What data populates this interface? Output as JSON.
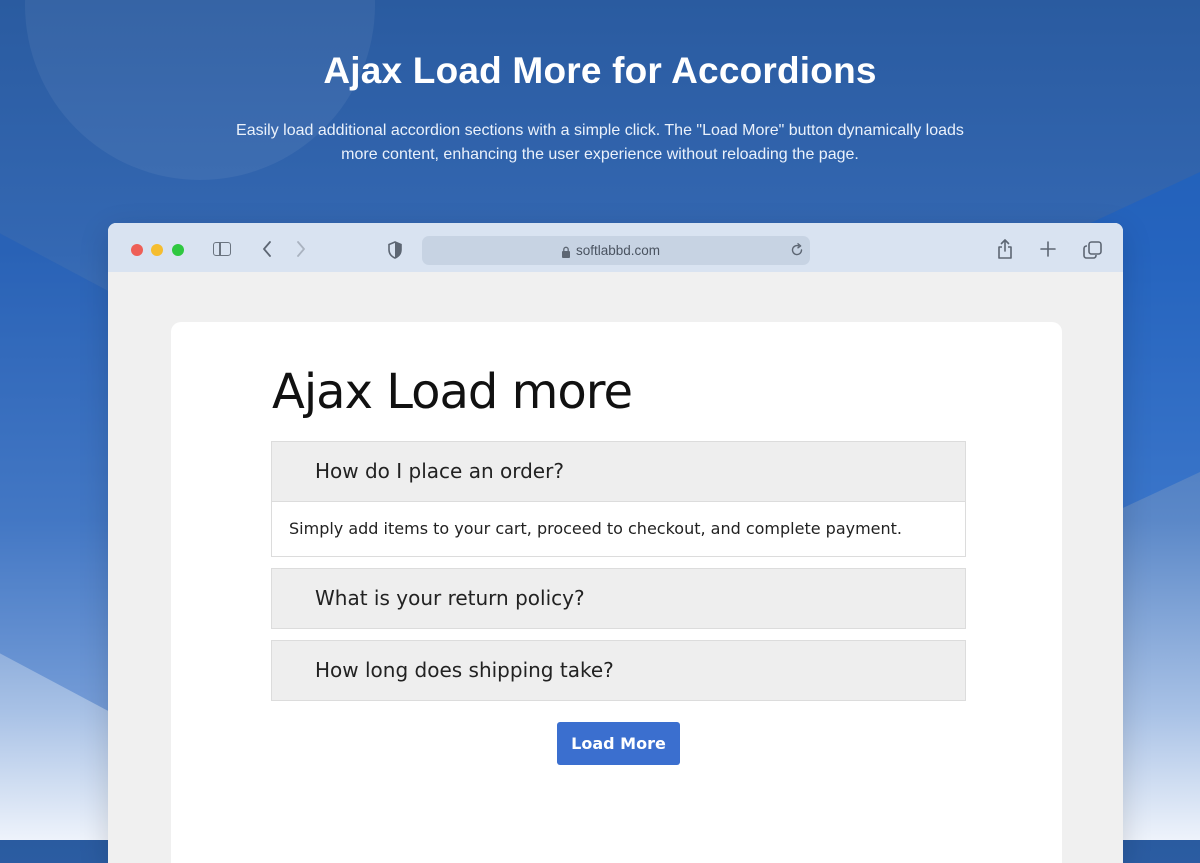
{
  "hero": {
    "title": "Ajax Load More for Accordions",
    "subtitle": "Easily load additional accordion sections with a simple click. The \"Load More\" button dynamically loads more content, enhancing the user experience without reloading the page."
  },
  "browser": {
    "url": "softlabbd.com",
    "icons": [
      "sidebar-icon",
      "back-icon",
      "forward-icon",
      "shield-icon",
      "lock-icon",
      "reload-icon",
      "share-icon",
      "new-tab-icon",
      "tabs-icon"
    ]
  },
  "page": {
    "title": "Ajax Load more",
    "accordion": [
      {
        "question": "How do I place an order?",
        "answer": "Simply add items to your cart, proceed to checkout, and complete payment.",
        "expanded": true
      },
      {
        "question": "What is your return policy?",
        "answer": "",
        "expanded": false
      },
      {
        "question": "How long does shipping take?",
        "answer": "",
        "expanded": false
      }
    ],
    "load_more_label": "Load More"
  },
  "colors": {
    "accent": "#3b6fcf",
    "background_top": "#2a5ba0",
    "background_bottom": "#eef3fb",
    "accordion_header": "#eeeeee"
  }
}
